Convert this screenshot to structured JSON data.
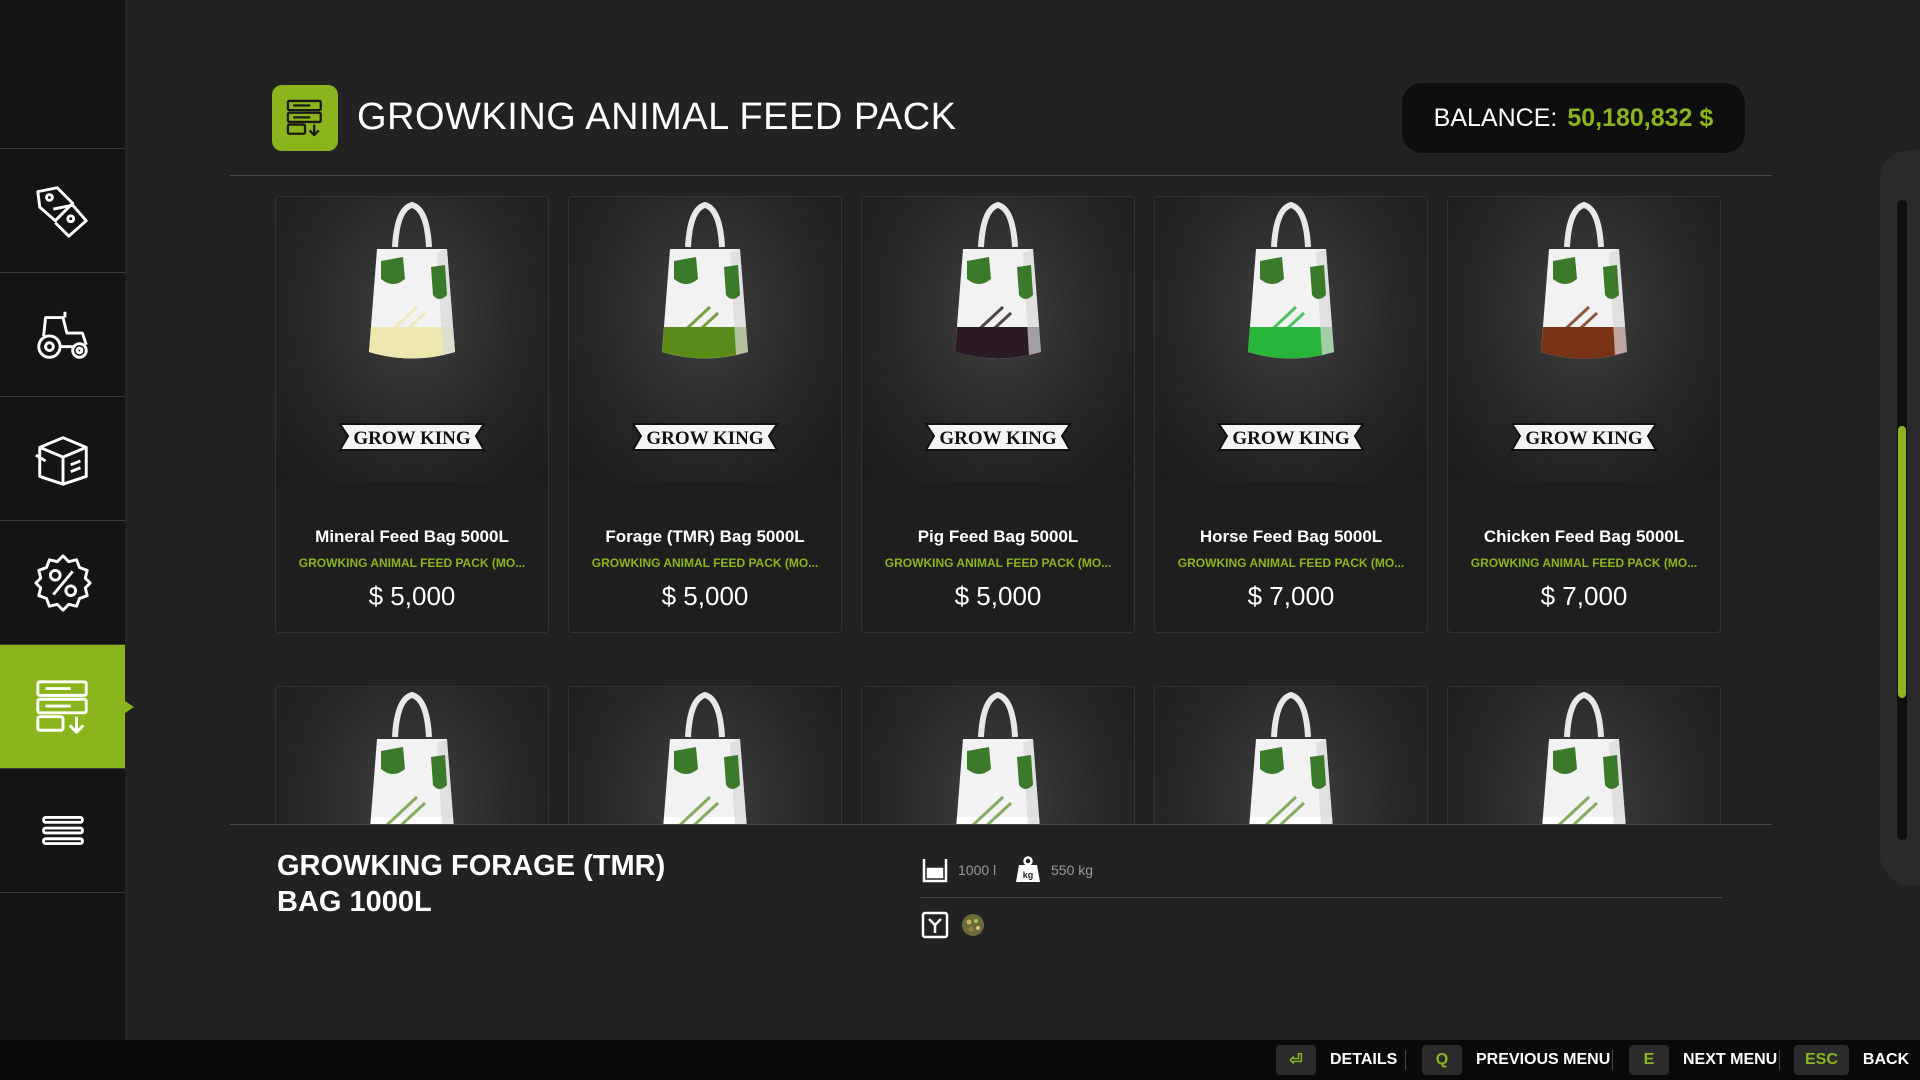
{
  "header": {
    "title": "GROWKING ANIMAL FEED PACK",
    "balance_label": "BALANCE:",
    "balance_value": "50,180,832 $"
  },
  "sidebar": {
    "items": [
      {
        "icon": "tags-icon",
        "active": false
      },
      {
        "icon": "tractor-icon",
        "active": false
      },
      {
        "icon": "box-icon",
        "active": false
      },
      {
        "icon": "percent-icon",
        "active": false
      },
      {
        "icon": "pack-download-icon",
        "active": true
      },
      {
        "icon": "menu-icon",
        "active": false
      }
    ]
  },
  "products": [
    {
      "name": "Mineral Feed Bag 5000L",
      "pack": "GROWKING ANIMAL FEED PACK (MO...",
      "price": "$ 5,000",
      "band": "#efe7b0",
      "brand": "GROW KING"
    },
    {
      "name": "Forage (TMR) Bag 5000L",
      "pack": "GROWKING ANIMAL FEED PACK (MO...",
      "price": "$ 5,000",
      "band": "#5a8a1a",
      "brand": "GROW KING"
    },
    {
      "name": "Pig Feed Bag 5000L",
      "pack": "GROWKING ANIMAL FEED PACK (MO...",
      "price": "$ 5,000",
      "band": "#2a1a26",
      "brand": "GROW KING"
    },
    {
      "name": "Horse Feed Bag 5000L",
      "pack": "GROWKING ANIMAL FEED PACK (MO...",
      "price": "$ 7,000",
      "band": "#28b53a",
      "brand": "GROW KING"
    },
    {
      "name": "Chicken Feed Bag 5000L",
      "pack": "GROWKING ANIMAL FEED PACK (MO...",
      "price": "$ 7,000",
      "band": "#7a3214",
      "brand": "GROW KING"
    },
    {
      "band": "#ffffff"
    },
    {
      "band": "#ffffff"
    },
    {
      "band": "#ffffff"
    },
    {
      "band": "#ffffff"
    },
    {
      "band": "#ffffff"
    }
  ],
  "details": {
    "title": "GROWKING FORAGE (TMR) BAG 1000L",
    "capacity": "1000 l",
    "weight": "550 kg"
  },
  "footer": {
    "details": {
      "key": "⏎",
      "label": "DETAILS"
    },
    "previous": {
      "key": "Q",
      "label": "PREVIOUS MENU"
    },
    "next": {
      "key": "E",
      "label": "NEXT MENU"
    },
    "back": {
      "key": "ESC",
      "label": "BACK"
    }
  },
  "colors": {
    "accent": "#8bb51d",
    "background": "#222222",
    "sidebar": "#141414"
  }
}
